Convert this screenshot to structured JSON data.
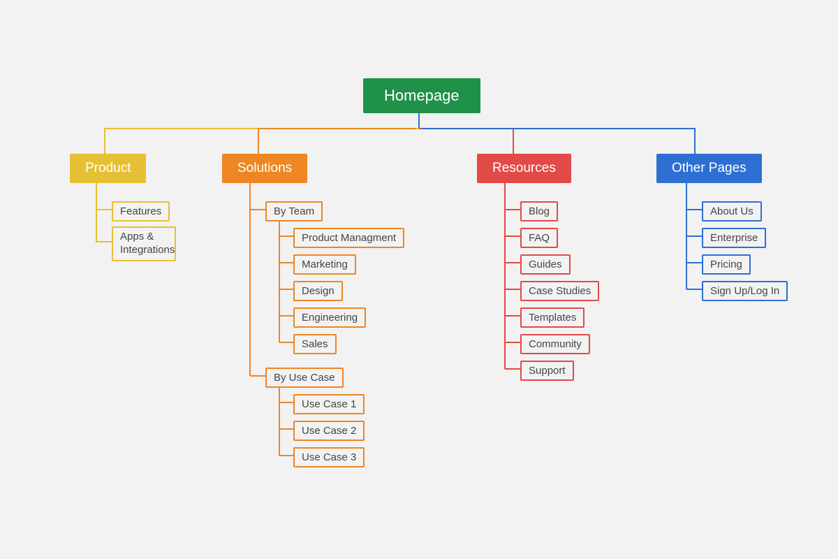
{
  "root": {
    "label": "Homepage"
  },
  "sections": {
    "product": {
      "label": "Product",
      "items": [
        {
          "label": "Features"
        },
        {
          "label": "Apps & Integrations"
        }
      ]
    },
    "solutions": {
      "label": "Solutions",
      "groups": [
        {
          "label": "By Team",
          "items": [
            {
              "label": "Product Managment"
            },
            {
              "label": "Marketing"
            },
            {
              "label": "Design"
            },
            {
              "label": "Engineering"
            },
            {
              "label": "Sales"
            }
          ]
        },
        {
          "label": "By Use Case",
          "items": [
            {
              "label": "Use Case 1"
            },
            {
              "label": "Use Case 2"
            },
            {
              "label": "Use Case 3"
            }
          ]
        }
      ]
    },
    "resources": {
      "label": "Resources",
      "items": [
        {
          "label": "Blog"
        },
        {
          "label": "FAQ"
        },
        {
          "label": "Guides"
        },
        {
          "label": "Case Studies"
        },
        {
          "label": "Templates"
        },
        {
          "label": "Community"
        },
        {
          "label": "Support"
        }
      ]
    },
    "other": {
      "label": "Other Pages",
      "items": [
        {
          "label": "About Us"
        },
        {
          "label": "Enterprise"
        },
        {
          "label": "Pricing"
        },
        {
          "label": "Sign Up/Log In"
        }
      ]
    }
  },
  "colors": {
    "root": "#209148",
    "product": "#e6c034",
    "solutions": "#ed8623",
    "resources": "#e24a48",
    "other": "#2d6fd2"
  }
}
